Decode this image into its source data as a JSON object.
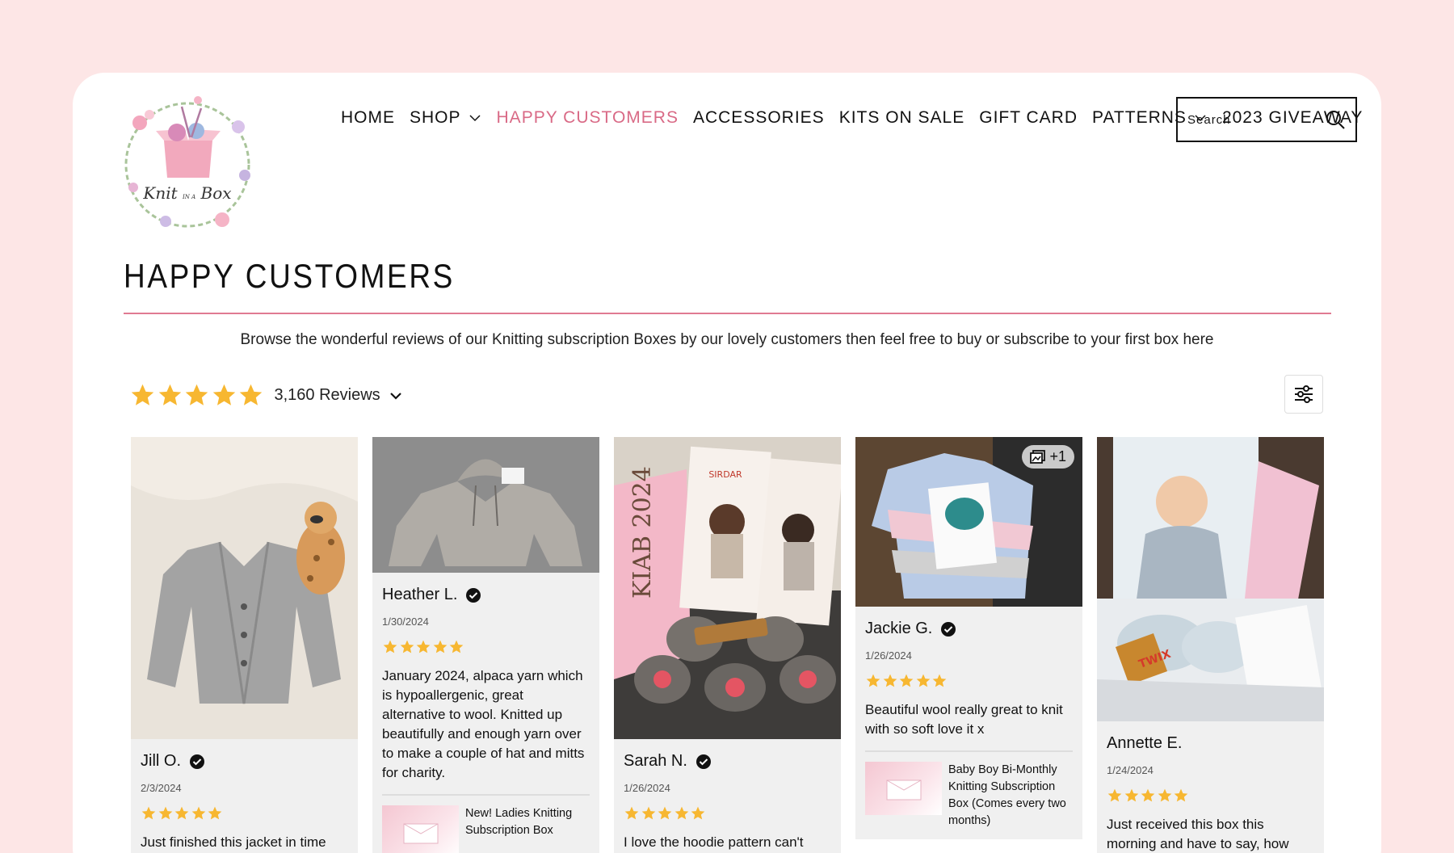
{
  "brand": {
    "logo_text": "Knit in a Box"
  },
  "nav": {
    "items": [
      {
        "label": "HOME",
        "dropdown": false,
        "active": false
      },
      {
        "label": "SHOP",
        "dropdown": true,
        "active": false
      },
      {
        "label": "HAPPY CUSTOMERS",
        "dropdown": false,
        "active": true
      },
      {
        "label": "ACCESSORIES",
        "dropdown": false,
        "active": false
      },
      {
        "label": "KITS ON SALE",
        "dropdown": false,
        "active": false
      },
      {
        "label": "GIFT CARD",
        "dropdown": false,
        "active": false
      },
      {
        "label": "PATTERNS",
        "dropdown": true,
        "active": false
      },
      {
        "label": "2023 GIVEAWAY",
        "dropdown": false,
        "active": false
      }
    ]
  },
  "search": {
    "placeholder": "Search",
    "icon": "search-icon"
  },
  "page": {
    "title": "HAPPY CUSTOMERS",
    "intro": "Browse the wonderful reviews of our Knitting subscription Boxes by our lovely customers then feel free to buy or subscribe to your first box here"
  },
  "summary": {
    "rating": 5,
    "review_count": "3,160 Reviews"
  },
  "colors": {
    "accent": "#d96a86",
    "star": "#f7b731",
    "page_bg": "#fde6e6"
  },
  "reviews": [
    {
      "name": "Jill O.",
      "date": "2/3/2024",
      "stars": 5,
      "text": "Just finished this jacket in time",
      "photo": "grey cable-knit cardigan with toy giraffe",
      "product": null,
      "badge": null
    },
    {
      "name": "Heather L.",
      "date": "1/30/2024",
      "stars": 5,
      "text": "January 2024, alpaca yarn which is hypoallergenic, great alternative to wool. Knitted up beautifully and enough yarn over to make a couple of hat and mitts for charity.",
      "photo": "grey knitted hoodie on carpet",
      "product": "New! Ladies Knitting Subscription Box",
      "badge": null
    },
    {
      "name": "Sarah N.",
      "date": "1/26/2024",
      "stars": 5,
      "text": "I love the hoodie pattern can't",
      "photo": "Sirdar patterns and grey yarn in box",
      "product": null,
      "badge": null
    },
    {
      "name": "Jackie G.",
      "date": "1/26/2024",
      "stars": 5,
      "text": "Beautiful wool really great to knit with so soft love it x",
      "photo": "striped pastel baby jumper",
      "product": "Baby Boy Bi-Monthly Knitting Subscription Box (Comes every two months)",
      "badge": "+1"
    },
    {
      "name": "Annette E.",
      "date": "1/24/2024",
      "stars": 5,
      "text": "Just received this box this morning and have to say, how",
      "photo": "baby pattern booklet with yarn and chocolate",
      "product": null,
      "badge": null
    }
  ]
}
